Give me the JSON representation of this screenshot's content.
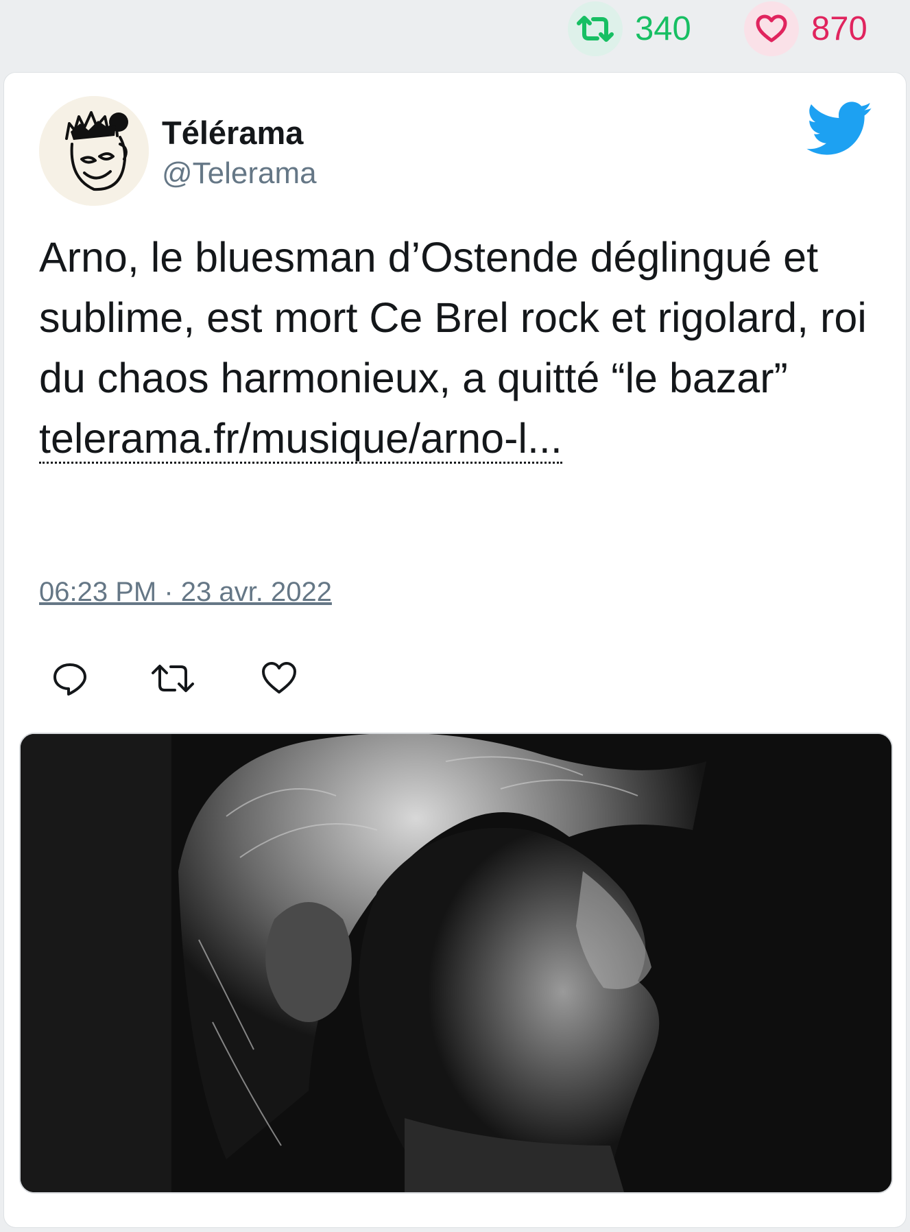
{
  "top_stats": {
    "retweets": "340",
    "likes": "870",
    "retweet_icon": "retweet-icon",
    "like_icon": "heart-icon",
    "colors": {
      "retweet": "#17bf63",
      "like": "#e0245e"
    }
  },
  "tweet": {
    "author_name": "Télérama",
    "author_handle": "@Telerama",
    "text": "Arno, le bluesman d’Ostende déglingué et sublime, est mort Ce Brel rock et rigolard, roi du chaos harmonieux, a quitté “le bazar”",
    "link_text": "telerama.fr/musique/arno-l...",
    "timestamp": "06:23 PM · 23 avr. 2022",
    "brand_icon": "twitter-bird-icon",
    "brand_color": "#1da1f2",
    "actions": [
      "reply-icon",
      "retweet-icon",
      "heart-icon"
    ],
    "media_description_icon": "photo-image"
  }
}
